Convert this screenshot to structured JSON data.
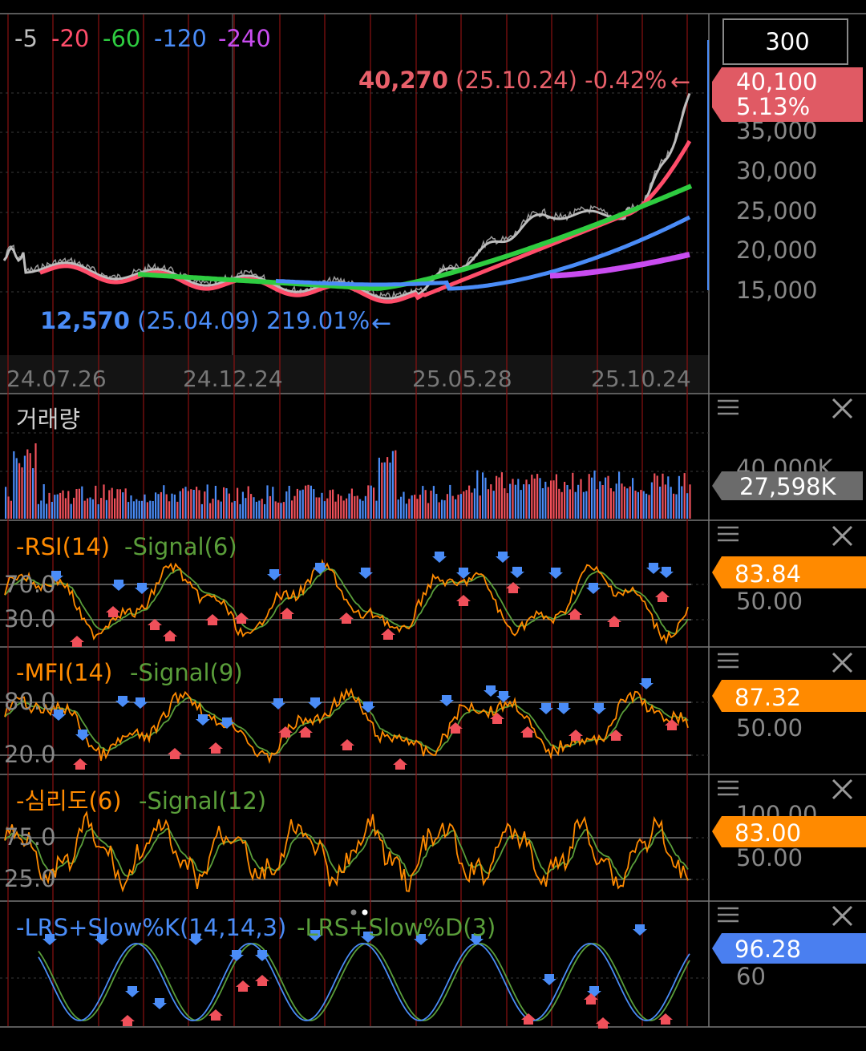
{
  "period_box": "300",
  "price_panel": {
    "legend": [
      {
        "label": "5",
        "color": "#bdbdbd"
      },
      {
        "label": "20",
        "color": "#ff4d6a"
      },
      {
        "label": "60",
        "color": "#2ecc40"
      },
      {
        "label": "120",
        "color": "#4a8cf7"
      },
      {
        "label": "240",
        "color": "#c94cf0"
      }
    ],
    "high_label": {
      "value": "40,270",
      "rest": " (25.10.24) -0.42%",
      "arrow": "←"
    },
    "low_label": {
      "value": "12,570",
      "rest": " (25.04.09) 219.01%",
      "arrow": "←"
    },
    "current_price": "40,100",
    "current_change": "5.13%",
    "y_ticks": [
      "35,000",
      "30,000",
      "25,000",
      "20,000",
      "15,000"
    ],
    "x_ticks": [
      "24.07.26",
      "24.12.24",
      "25.05.28",
      "25.10.24"
    ]
  },
  "volume_panel": {
    "title": "거래량",
    "axis_label": "40,000K",
    "current": "27,598K"
  },
  "rsi_panel": {
    "title": "RSI(14)",
    "signal": "Signal(6)",
    "levels": [
      "70.0",
      "30.0"
    ],
    "current": "83.84",
    "axis_label": "50.00"
  },
  "mfi_panel": {
    "title": "MFI(14)",
    "signal": "Signal(9)",
    "levels": [
      "80.0",
      "20.0"
    ],
    "current": "87.32",
    "axis_label": "50.00"
  },
  "psy_panel": {
    "title": "심리도(6)",
    "signal": "Signal(12)",
    "levels": [
      "75.0",
      "25.0"
    ],
    "axis_label_top": "100.00",
    "current": "83.00",
    "axis_label": "50.00"
  },
  "lrs_panel": {
    "title": "LRS+Slow%K(14,14,3)",
    "signal": "LRS+Slow%D(3)",
    "current": "96.28",
    "axis_label": "60"
  },
  "colors": {
    "up": "#f0505a",
    "down": "#4a8cf7",
    "orange": "#ff8a00",
    "green": "#5a9e3a",
    "price_label_bg": "#e05a64",
    "volume_label_bg": "#6b6b6b",
    "lrs_label_bg": "#4a7ff0"
  },
  "icons": [
    "menu-icon",
    "close-icon"
  ]
}
